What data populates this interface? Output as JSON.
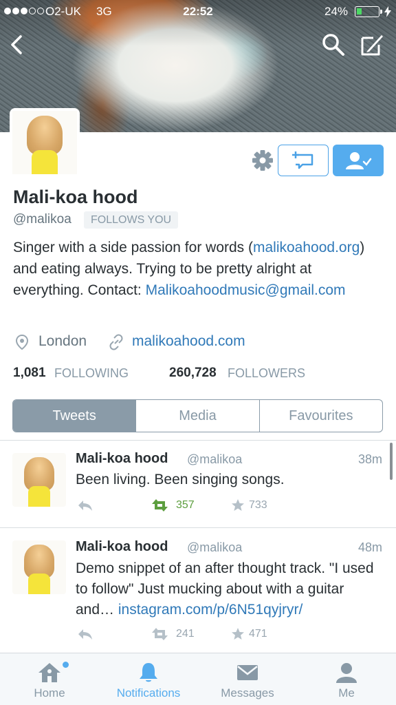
{
  "status_bar": {
    "carrier": "O2-UK",
    "network": "3G",
    "time": "22:52",
    "battery": "24%",
    "battery_level": 0.24,
    "signal_bars_filled": 3,
    "signal_bars_total": 5
  },
  "header": {
    "back_icon": "chevron-left-icon",
    "search_icon": "search-icon",
    "compose_icon": "compose-icon"
  },
  "profile": {
    "name": "Mali-koa hood",
    "handle": "@malikoa",
    "follows_you": "FOLLOWS YOU",
    "bio_lead": "Singer with a side passion for words (",
    "bio_link": "malikoahood.org",
    "bio_mid": ") and eating always. Trying to be pretty alright at everything. Contact: ",
    "bio_email": "Malikoahoodmusic@gmail.com",
    "location": "London",
    "website": "malikoahood.com",
    "following_count": "1,081",
    "following_label": "FOLLOWING",
    "followers_count": "260,728",
    "followers_label": "FOLLOWERS"
  },
  "tabs": [
    {
      "label": "Tweets",
      "active": true
    },
    {
      "label": "Media",
      "active": false
    },
    {
      "label": "Favourites",
      "active": false
    }
  ],
  "tweets": [
    {
      "author": "Mali-koa hood",
      "handle": "@malikoa",
      "time": "38m",
      "text": "Been living. Been singing songs.",
      "retweets": "357",
      "favourites": "733",
      "retweeted": true
    },
    {
      "author": "Mali-koa hood",
      "handle": "@malikoa",
      "time": "48m",
      "text": "Demo snippet of an after thought track. \"I used to follow\" Just mucking about with a guitar and… ",
      "link": "instagram.com/p/6N51qyjryr/",
      "retweets": "241",
      "favourites": "471",
      "retweeted": false
    }
  ],
  "bottom_nav": [
    {
      "label": "Home",
      "icon": "home-icon",
      "active": false
    },
    {
      "label": "Notifications",
      "icon": "bell-icon",
      "active": true
    },
    {
      "label": "Messages",
      "icon": "envelope-icon",
      "active": false
    },
    {
      "label": "Me",
      "icon": "person-icon",
      "active": false
    }
  ],
  "colors": {
    "accent": "#55acee",
    "link": "#3079b8",
    "retweet_green": "#5c9e3e",
    "muted": "#8899a6"
  }
}
